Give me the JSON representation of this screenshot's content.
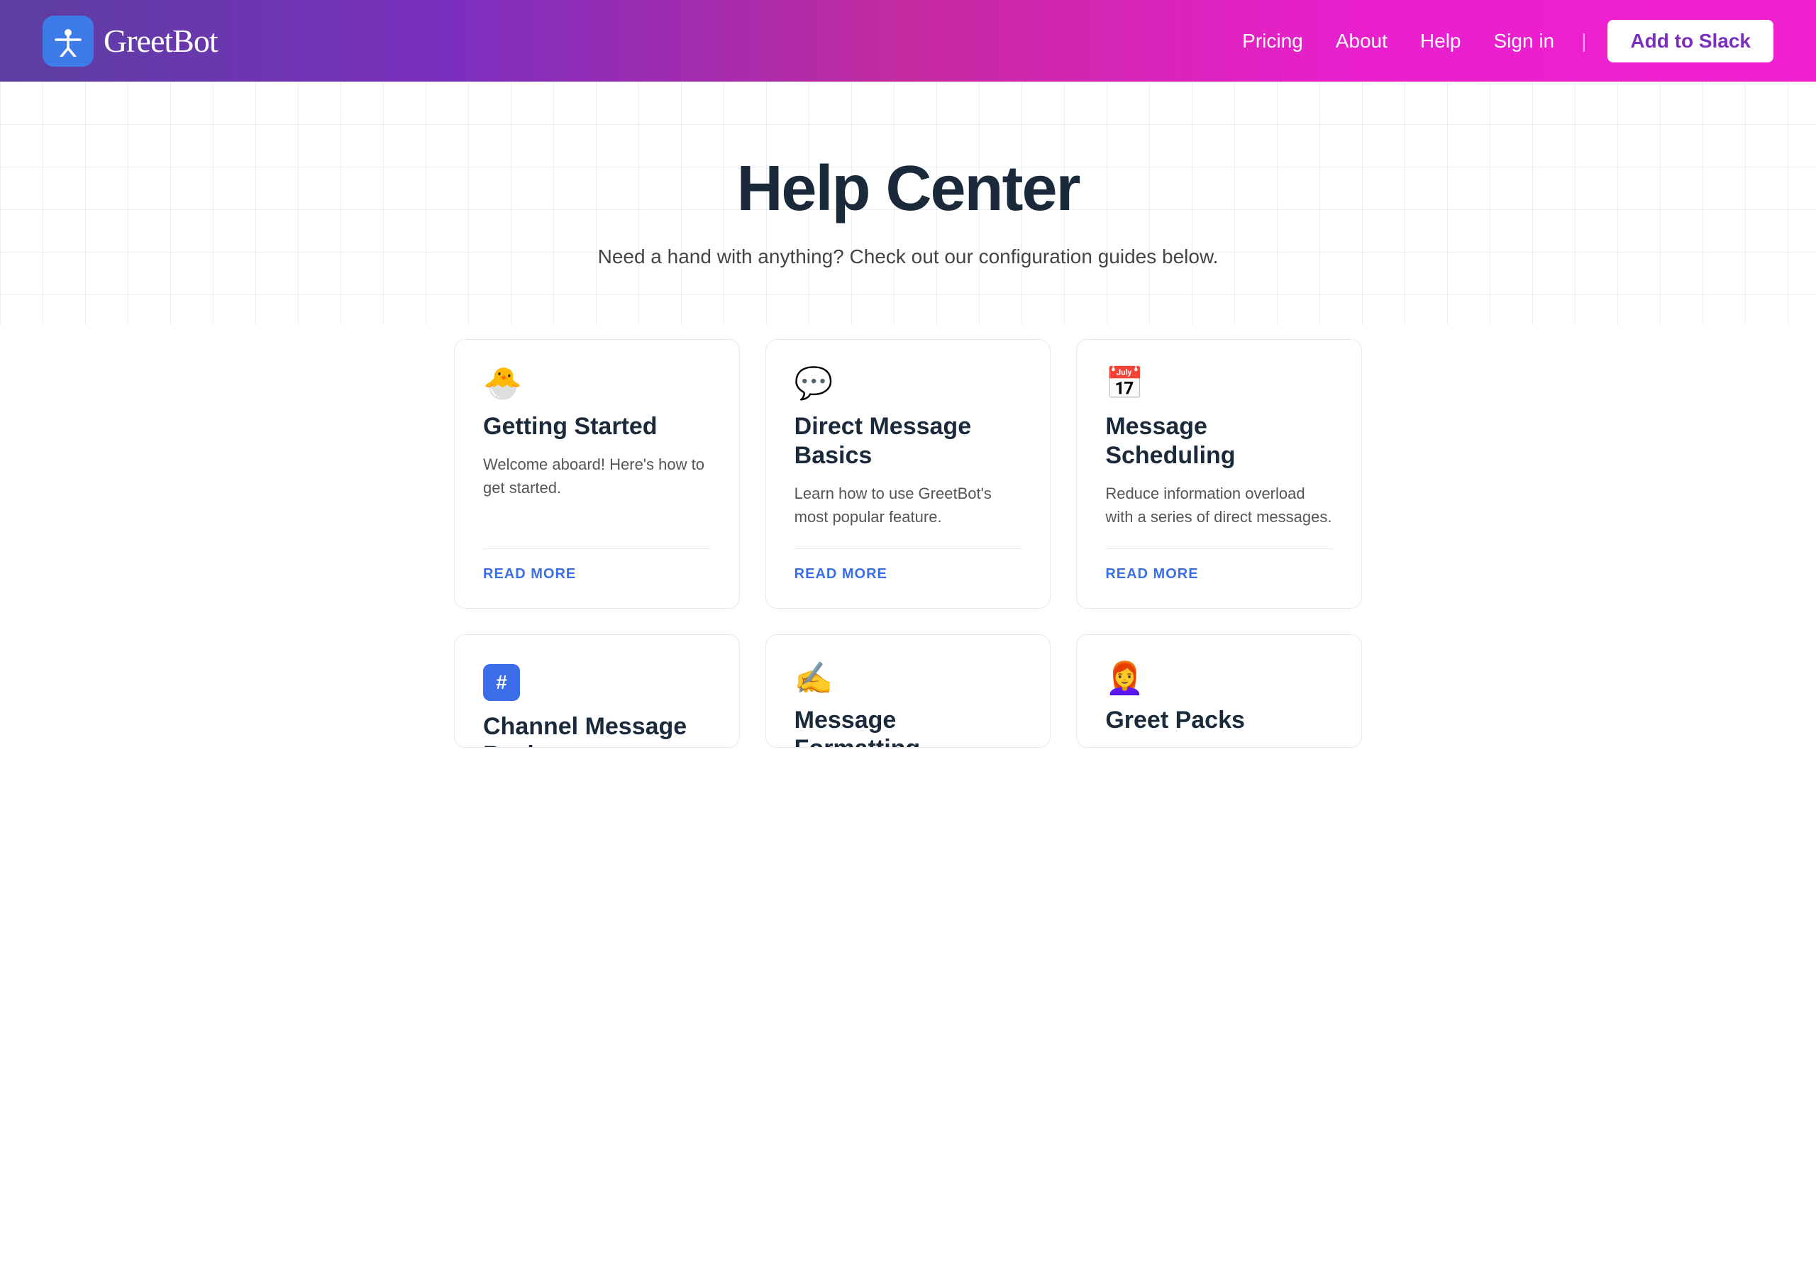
{
  "header": {
    "logo_text": "GreetBot",
    "logo_icon": "✳",
    "nav": {
      "pricing": "Pricing",
      "about": "About",
      "help": "Help",
      "sign_in": "Sign in",
      "add_to_slack": "Add to Slack"
    }
  },
  "hero": {
    "title": "Help Center",
    "subtitle": "Need a hand with anything? Check out our configuration guides below."
  },
  "cards": [
    {
      "icon": "🐣",
      "title": "Getting Started",
      "description": "Welcome aboard! Here's how to get started.",
      "read_more": "READ MORE"
    },
    {
      "icon": "💬",
      "title": "Direct Message Basics",
      "description": "Learn how to use GreetBot's most popular feature.",
      "read_more": "READ MORE"
    },
    {
      "icon": "📅",
      "title": "Message Scheduling",
      "description": "Reduce information overload with a series of direct messages.",
      "read_more": "READ MORE"
    }
  ],
  "cards_bottom": [
    {
      "icon": "🔢",
      "title": "Channel Message Basics"
    },
    {
      "icon": "✍️",
      "title": "Message Formatting"
    },
    {
      "icon": "👩‍🦰",
      "title": "Greet Packs"
    }
  ]
}
